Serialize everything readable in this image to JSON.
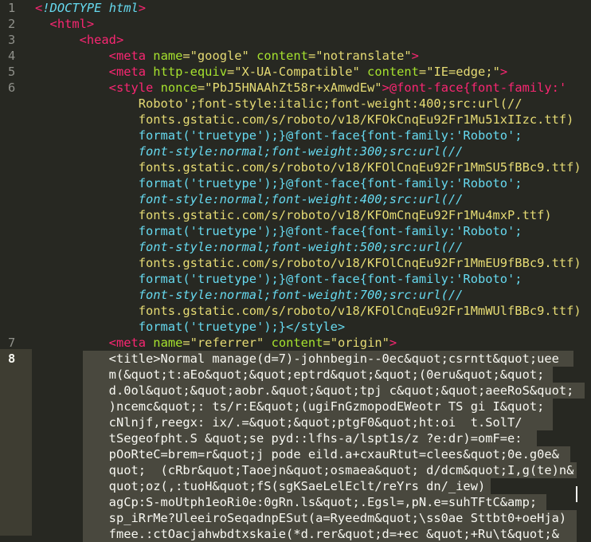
{
  "line_numbers": [
    "1",
    "2",
    "3",
    "4",
    "5",
    "6",
    "7",
    "8"
  ],
  "code": {
    "l1": [
      "<!DOCTYPE html>"
    ],
    "l2": [
      "<html>"
    ],
    "l3": [
      "<head>"
    ],
    "l4": [
      "<meta",
      "name",
      "=\"google\"",
      "content",
      "=\"notranslate\"",
      ">"
    ],
    "l5": [
      "<meta",
      "http-equiv",
      "=\"X-UA-Compatible\"",
      "content",
      "=\"IE=edge;\"",
      ">"
    ],
    "l6": [
      "<style",
      "nonce",
      "=\"PbJ5HNAAhZt58r+xAmwdEw\"",
      ">@font-face{font-family:'"
    ],
    "l6b": [
      "Roboto';font-style:italic;font-weight:400;src:url(//"
    ],
    "l6c": [
      "fonts.gstatic.com/s/roboto/v18/KFOkCnqEu92Fr1Mu51xIIzc.ttf)"
    ],
    "l6d": [
      "format('truetype');}@font-face{font-family:'Roboto';"
    ],
    "l6e": [
      "font-style:normal;font-weight:300;src:url(//"
    ],
    "l6f": [
      "fonts.gstatic.com/s/roboto/v18/KFOlCnqEu92Fr1MmSU5fBBc9.ttf)"
    ],
    "l6g": [
      "format('truetype');}@font-face{font-family:'Roboto';"
    ],
    "l6h": [
      "font-style:normal;font-weight:400;src:url(//"
    ],
    "l6i": [
      "fonts.gstatic.com/s/roboto/v18/KFOmCnqEu92Fr1Mu4mxP.ttf)"
    ],
    "l6j": [
      "format('truetype');}@font-face{font-family:'Roboto';"
    ],
    "l6k": [
      "font-style:normal;font-weight:500;src:url(//"
    ],
    "l6l": [
      "fonts.gstatic.com/s/roboto/v18/KFOlCnqEu92Fr1MmEU9fBBc9.ttf)"
    ],
    "l6m": [
      "format('truetype');}@font-face{font-family:'Roboto';"
    ],
    "l6n": [
      "font-style:normal;font-weight:700;src:url(//"
    ],
    "l6o": [
      "fonts.gstatic.com/s/roboto/v18/KFOlCnqEu92Fr1MmWUlfBBc9.ttf)"
    ],
    "l6p": [
      "format('truetype');}</style>"
    ],
    "l7": [
      "<meta",
      "name",
      "=\"referrer\"",
      "content",
      "=\"origin\"",
      ">"
    ],
    "l8a": "<title>Normal manage(d=7)-johnbegin--0ec&quot;csrntt&quot;uee",
    "l8b": "m(&quot;t:aEo&quot;&quot;eptrd&quot;&quot;(0eru&quot;&quot;",
    "l8c": "d.0ol&quot;&quot;aobr.&quot;&quot;tpj c&quot;&quot;aeeRoS&quot;",
    "l8d": ")ncemc&quot;: ts/r:E&quot;(ugiFnGzmopodEWeotr TS gi I&quot;",
    "l8e": "cNlnjf,reegx: ix/.=&quot;&quot;ptgF0&quot;ht:oi  t.SolT/",
    "l8f": "tSegeofpht.S &quot;se pyd::lfhs-a/lspt1s/z ?e:dr)=omF=e: ",
    "l8g": "pOoRteC=brem=r&quot;j pode eild.a+cxauRtut=clees&quot;0e.g0e&",
    "l8h": "quot;  (cRbr&quot;Taoejn&quot;osmaea&quot; d/dcm&quot;I,g(te)n&",
    "l8i": "quot;oz(,:tuoH&quot;fS(sgKSaeLelEclt/reYrs dn/_iew)",
    "l8j": "agCp:S-moUtph1eoRi0e:0gRn.ls&quot;.Egsl=,pN.e=suhTFtC&amp;",
    "l8k": "sp_iRrMe?UleeiroSeqadnpESut(a=Ryeedm&quot;\\ss0ae Sttbt0+oeHja)",
    "l8l": "fmee.:ctOacjahwbdtxskaie(*d.rer&quot;d=+ec &quot;+Ru\\t&quot;&"
  }
}
